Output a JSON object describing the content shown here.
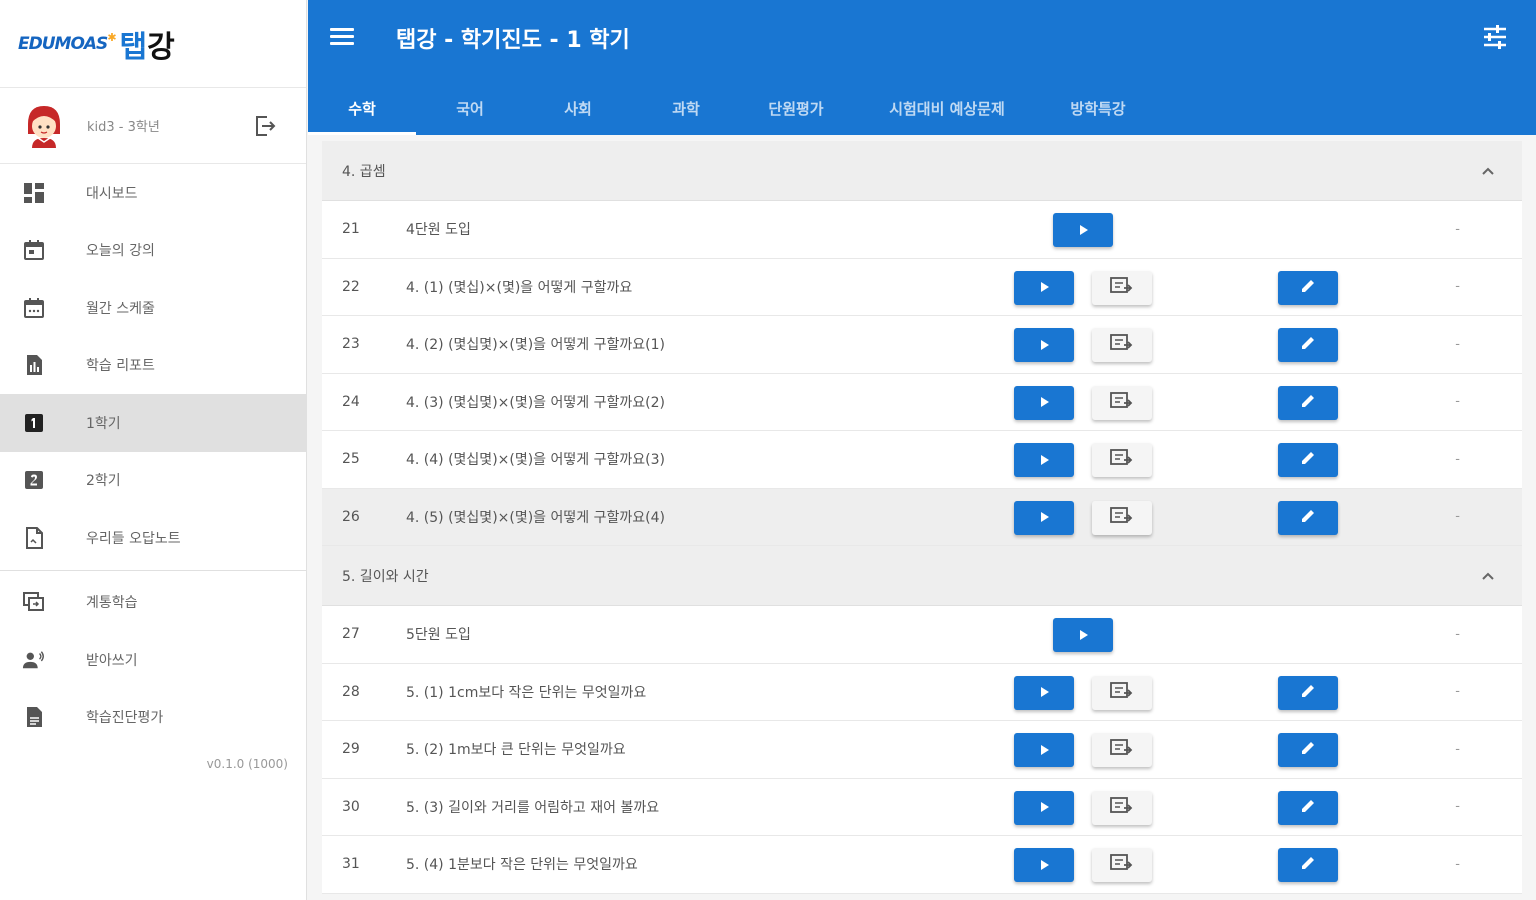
{
  "app": {
    "logo_edu": "EDUMOAS",
    "logo_tab_1": "탭",
    "logo_tab_2": "강"
  },
  "user": {
    "name": "kid3 - 3학년"
  },
  "sidebar": {
    "items": [
      {
        "label": "대시보드",
        "icon": "dashboard-icon"
      },
      {
        "label": "오늘의 강의",
        "icon": "calendar-today-icon"
      },
      {
        "label": "월간 스케줄",
        "icon": "calendar-month-icon"
      },
      {
        "label": "학습 리포트",
        "icon": "report-icon"
      },
      {
        "label": "1학기",
        "icon": "number-one-box-icon",
        "active": true
      },
      {
        "label": "2학기",
        "icon": "number-two-box-icon"
      },
      {
        "label": "우리들 오답노트",
        "icon": "note-icon"
      },
      {
        "label": "계통학습",
        "icon": "hierarchy-icon"
      },
      {
        "label": "받아쓰기",
        "icon": "dictation-icon"
      },
      {
        "label": "학습진단평가",
        "icon": "assessment-icon"
      }
    ],
    "version": "v0.1.0 (1000)"
  },
  "header": {
    "title": "탭강 - 학기진도 - 1 학기",
    "tabs": [
      "수학",
      "국어",
      "사회",
      "과학",
      "단원평가",
      "시험대비 예상문제",
      "방학특강"
    ],
    "active_tab": 0
  },
  "sections": [
    {
      "title": "4. 곱셈",
      "rows": [
        {
          "num": "21",
          "title": "4단원 도입",
          "type": "intro",
          "status": "-"
        },
        {
          "num": "22",
          "title": "4. (1) (몇십)×(몇)을 어떻게 구할까요",
          "type": "full",
          "status": "-"
        },
        {
          "num": "23",
          "title": "4. (2) (몇십몇)×(몇)을 어떻게 구할까요(1)",
          "type": "full",
          "status": "-"
        },
        {
          "num": "24",
          "title": "4. (3) (몇십몇)×(몇)을 어떻게 구할까요(2)",
          "type": "full",
          "status": "-"
        },
        {
          "num": "25",
          "title": "4. (4) (몇십몇)×(몇)을 어떻게 구할까요(3)",
          "type": "full",
          "status": "-"
        },
        {
          "num": "26",
          "title": "4. (5) (몇십몇)×(몇)을 어떻게 구할까요(4)",
          "type": "full",
          "status": "-",
          "highlight": true
        }
      ]
    },
    {
      "title": "5. 길이와 시간",
      "rows": [
        {
          "num": "27",
          "title": "5단원 도입",
          "type": "intro",
          "status": "-"
        },
        {
          "num": "28",
          "title": "5. (1) 1cm보다 작은 단위는 무엇일까요",
          "type": "full",
          "status": "-"
        },
        {
          "num": "29",
          "title": "5. (2) 1m보다 큰 단위는 무엇일까요",
          "type": "full",
          "status": "-"
        },
        {
          "num": "30",
          "title": "5. (3) 길이와 거리를 어림하고 재어 볼까요",
          "type": "full",
          "status": "-"
        },
        {
          "num": "31",
          "title": "5. (4) 1분보다 작은 단위는 무엇일까요",
          "type": "full",
          "status": "-"
        }
      ]
    }
  ],
  "colors": {
    "primary": "#1976d2",
    "sidebar_active": "#e0e0e0"
  }
}
